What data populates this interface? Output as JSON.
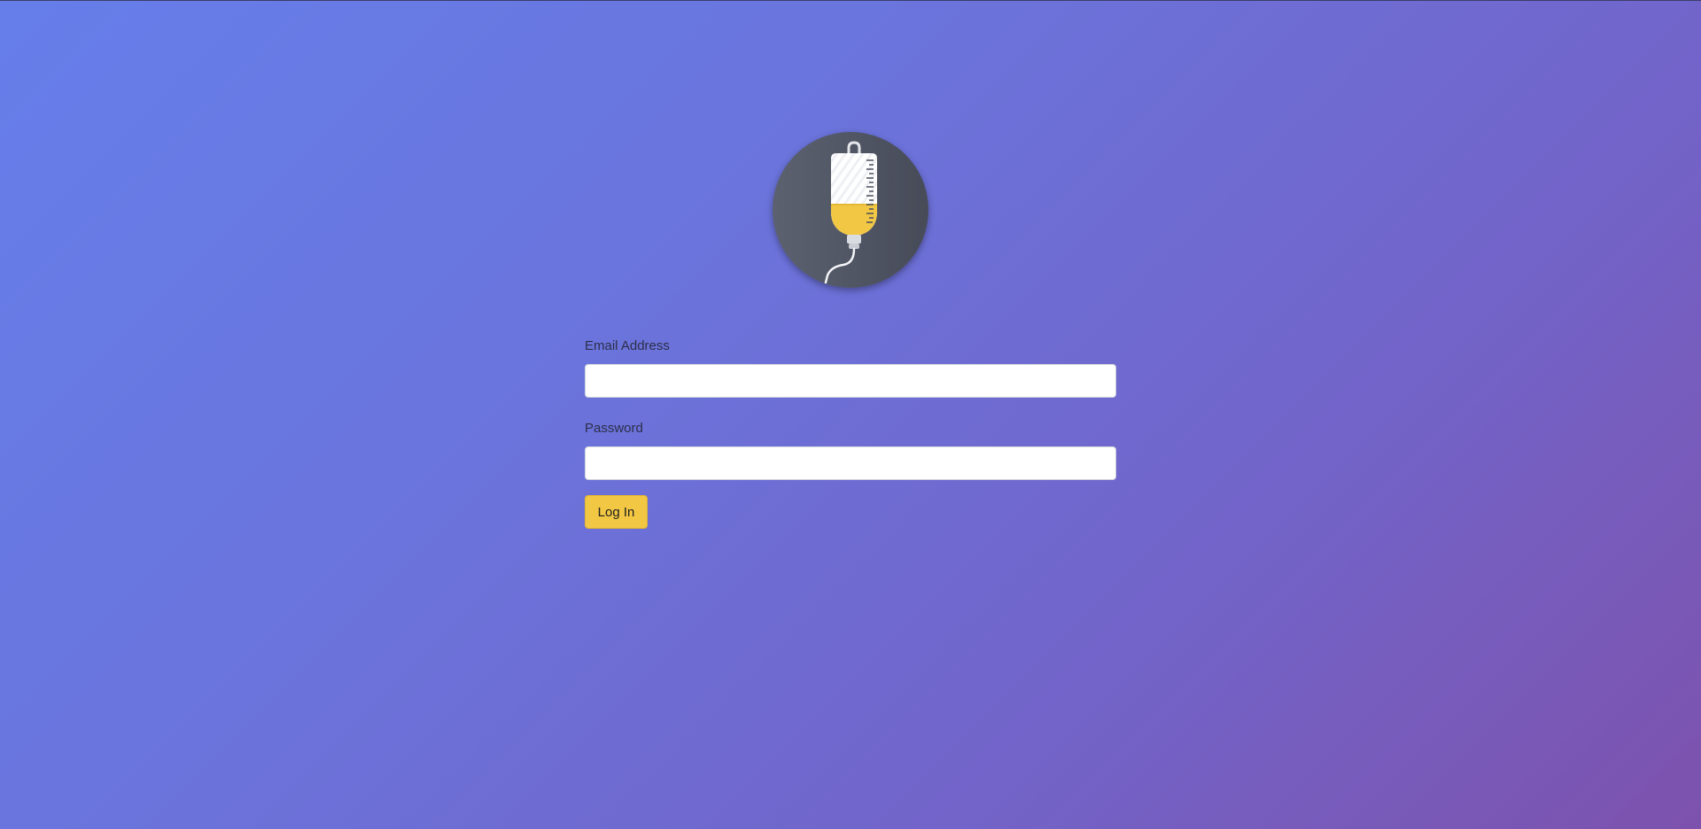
{
  "logo": {
    "icon": "iv-drip-bag-icon",
    "colors": {
      "circle": "#545967",
      "bag": "#ffffff",
      "fluid": "#f2c744"
    }
  },
  "login_form": {
    "email": {
      "label": "Email Address",
      "value": "",
      "placeholder": ""
    },
    "password": {
      "label": "Password",
      "value": "",
      "placeholder": ""
    },
    "submit_label": "Log In"
  },
  "colors": {
    "accent": "#f2c744",
    "background_start": "#667eea",
    "background_end": "#7d52ad"
  }
}
